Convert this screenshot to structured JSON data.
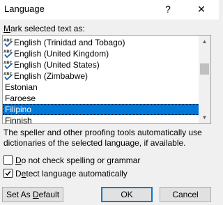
{
  "window": {
    "title": "Language",
    "help_glyph": "?",
    "close_glyph": "✕"
  },
  "list": {
    "label_prefix": "M",
    "label_rest": "ark selected text as:",
    "items": [
      {
        "label": "English (Trinidad and Tobago)",
        "spell": true
      },
      {
        "label": "English (United Kingdom)",
        "spell": true
      },
      {
        "label": "English (United States)",
        "spell": true
      },
      {
        "label": "English (Zimbabwe)",
        "spell": true
      },
      {
        "label": "Estonian",
        "spell": false
      },
      {
        "label": "Faroese",
        "spell": false
      },
      {
        "label": "Filipino",
        "spell": false,
        "selected": true
      },
      {
        "label": "Finnish",
        "spell": false
      }
    ],
    "scroll_up": "▲",
    "scroll_down": "▼"
  },
  "description": "The speller and other proofing tools automatically use dictionaries of the selected language, if available.",
  "options": {
    "no_check_prefix": "",
    "no_check_ul": "D",
    "no_check_rest": "o not check spelling or grammar",
    "no_check_checked": false,
    "detect_prefix": "D",
    "detect_ul": "e",
    "detect_rest": "tect language automatically",
    "detect_checked": true
  },
  "buttons": {
    "default_prefix": "Set As ",
    "default_ul": "D",
    "default_rest": "efault",
    "ok": "OK",
    "cancel": "Cancel"
  }
}
